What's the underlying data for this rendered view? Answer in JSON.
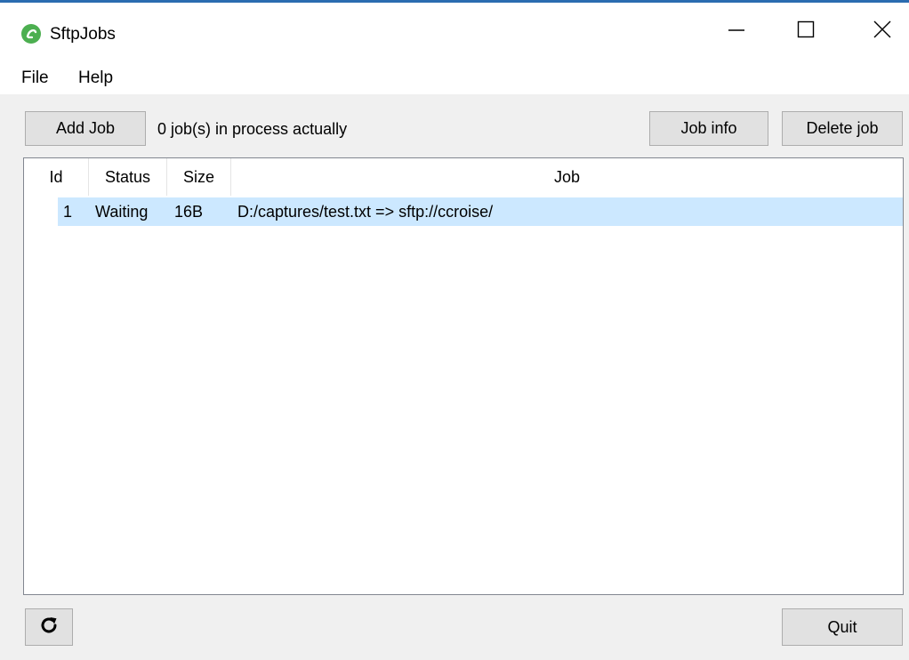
{
  "window": {
    "title": "SftpJobs",
    "icon": "sftpjobs-app-icon",
    "controls": [
      "minimize-icon",
      "maximize-icon",
      "close-icon"
    ]
  },
  "menu": {
    "items": [
      {
        "label": "File"
      },
      {
        "label": "Help"
      }
    ]
  },
  "toolbar": {
    "add_job_label": "Add Job",
    "status_text": "0 job(s) in process actually",
    "job_info_label": "Job info",
    "delete_job_label": "Delete job"
  },
  "table": {
    "columns": [
      "Id",
      "Status",
      "Size",
      "Job"
    ],
    "rows": [
      {
        "id": "1",
        "status": "Waiting",
        "size": "16B",
        "job": "D:/captures/test.txt => sftp://ccroise/",
        "selected": true
      }
    ]
  },
  "footer": {
    "refresh_icon": "refresh-icon",
    "quit_label": "Quit"
  },
  "colors": {
    "selection": "#cce8ff",
    "accent": "#2b6cb0",
    "app_icon": "#4caf50"
  }
}
